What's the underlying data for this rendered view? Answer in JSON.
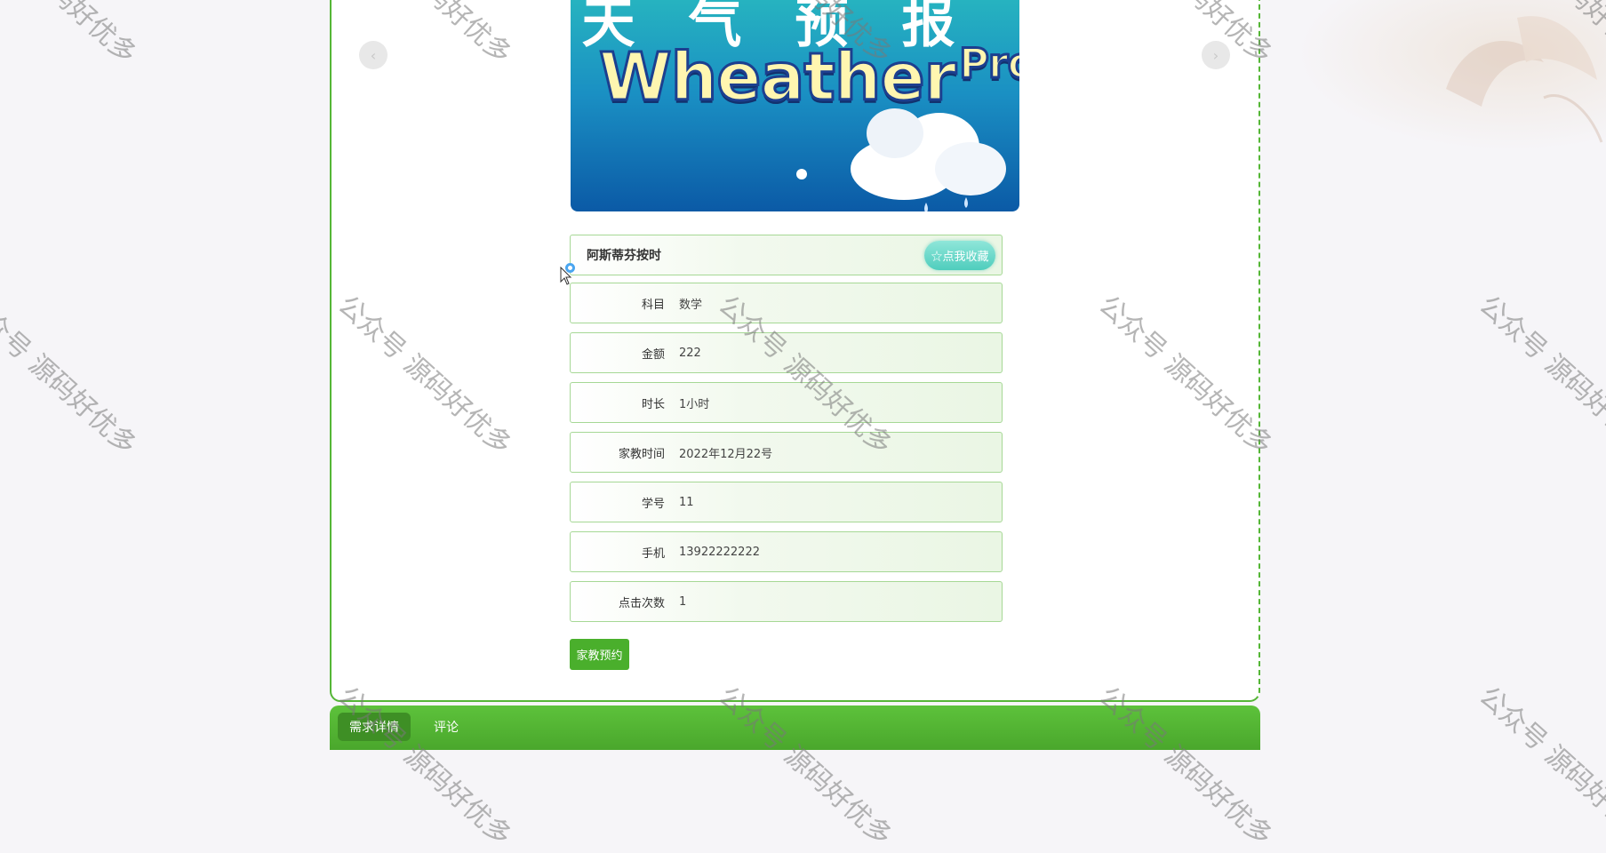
{
  "carousel": {
    "title_cn": "天气预报",
    "title_en": "Wheather",
    "title_sup": "Pro",
    "prev_icon": "‹",
    "next_icon": "›"
  },
  "detail": {
    "name": "阿斯蒂芬按时",
    "favorite_label": "☆点我收藏",
    "fields": [
      {
        "label": "科目",
        "value": "数学"
      },
      {
        "label": "金额",
        "value": "222"
      },
      {
        "label": "时长",
        "value": "1小时"
      },
      {
        "label": "家教时间",
        "value": "2022年12月22号"
      },
      {
        "label": "学号",
        "value": "11"
      },
      {
        "label": "手机",
        "value": "13922222222"
      },
      {
        "label": "点击次数",
        "value": "1"
      }
    ],
    "book_label": "家教预约"
  },
  "tabs": [
    {
      "label": "需求详情"
    },
    {
      "label": "评论"
    }
  ],
  "watermark": "公众号 源码好优多",
  "colors": {
    "accent_green": "#4aaf2c",
    "card_border": "#a6d895",
    "favorite_teal": "#4fcdbd"
  }
}
